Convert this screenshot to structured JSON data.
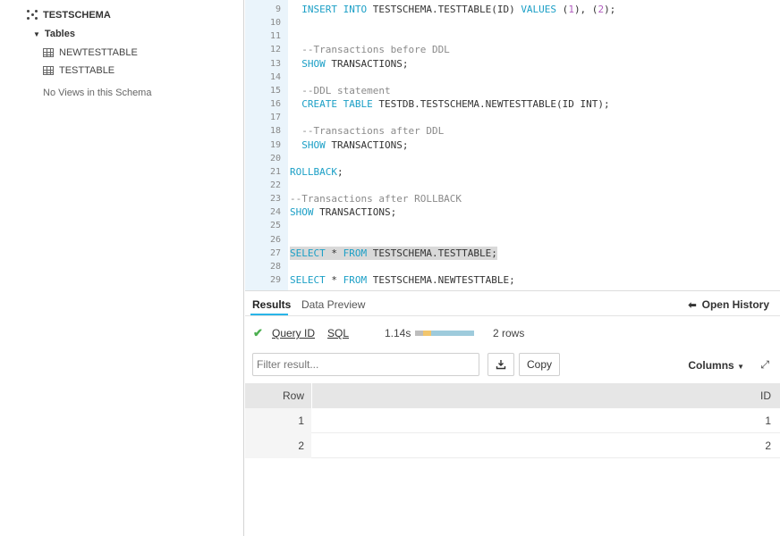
{
  "sidebar": {
    "schema": "TESTSCHEMA",
    "tables_label": "Tables",
    "tables": [
      "NEWTESTTABLE",
      "TESTTABLE"
    ],
    "no_views": "No Views in this Schema"
  },
  "editor": {
    "lines": [
      {
        "n": "9",
        "text": "  INSERT INTO TESTSCHEMA.TESTTABLE(ID) VALUES (1), (2);"
      },
      {
        "n": "10",
        "text": ""
      },
      {
        "n": "11",
        "text": ""
      },
      {
        "n": "12",
        "text": "  --Transactions before DDL"
      },
      {
        "n": "13",
        "text": "  SHOW TRANSACTIONS;"
      },
      {
        "n": "14",
        "text": ""
      },
      {
        "n": "15",
        "text": "  --DDL statement"
      },
      {
        "n": "16",
        "text": "  CREATE TABLE TESTDB.TESTSCHEMA.NEWTESTTABLE(ID INT);"
      },
      {
        "n": "17",
        "text": ""
      },
      {
        "n": "18",
        "text": "  --Transactions after DDL"
      },
      {
        "n": "19",
        "text": "  SHOW TRANSACTIONS;"
      },
      {
        "n": "20",
        "text": ""
      },
      {
        "n": "21",
        "text": "ROLLBACK;"
      },
      {
        "n": "22",
        "text": ""
      },
      {
        "n": "23",
        "text": "--Transactions after ROLLBACK"
      },
      {
        "n": "24",
        "text": "SHOW TRANSACTIONS;"
      },
      {
        "n": "25",
        "text": ""
      },
      {
        "n": "26",
        "text": ""
      },
      {
        "n": "27",
        "text": "SELECT * FROM TESTSCHEMA.TESTTABLE;"
      },
      {
        "n": "28",
        "text": ""
      },
      {
        "n": "29",
        "text": "SELECT * FROM TESTSCHEMA.NEWTESTTABLE;"
      }
    ],
    "highlighted_line": "27"
  },
  "results": {
    "tabs": [
      "Results",
      "Data Preview"
    ],
    "active_tab": "Results",
    "open_history": "Open History",
    "query_id_label": "Query ID",
    "sql_label": "SQL",
    "duration": "1.14s",
    "rows_label": "2 rows",
    "filter_placeholder": "Filter result...",
    "copy_label": "Copy",
    "columns_label": "Columns",
    "table": {
      "headers": [
        "Row",
        "ID"
      ],
      "rows": [
        [
          "1",
          "1"
        ],
        [
          "2",
          "2"
        ]
      ]
    }
  },
  "colors": {
    "keyword": "#1b9fc6",
    "number": "#b15cbf",
    "comment": "#8a8a8a",
    "success": "#4caf50",
    "accent": "#29b5e8"
  },
  "icons": [
    "schema-icon",
    "table-icon",
    "check-icon",
    "download-icon",
    "expand-icon",
    "arrow-left-icon",
    "caret-down-icon"
  ]
}
